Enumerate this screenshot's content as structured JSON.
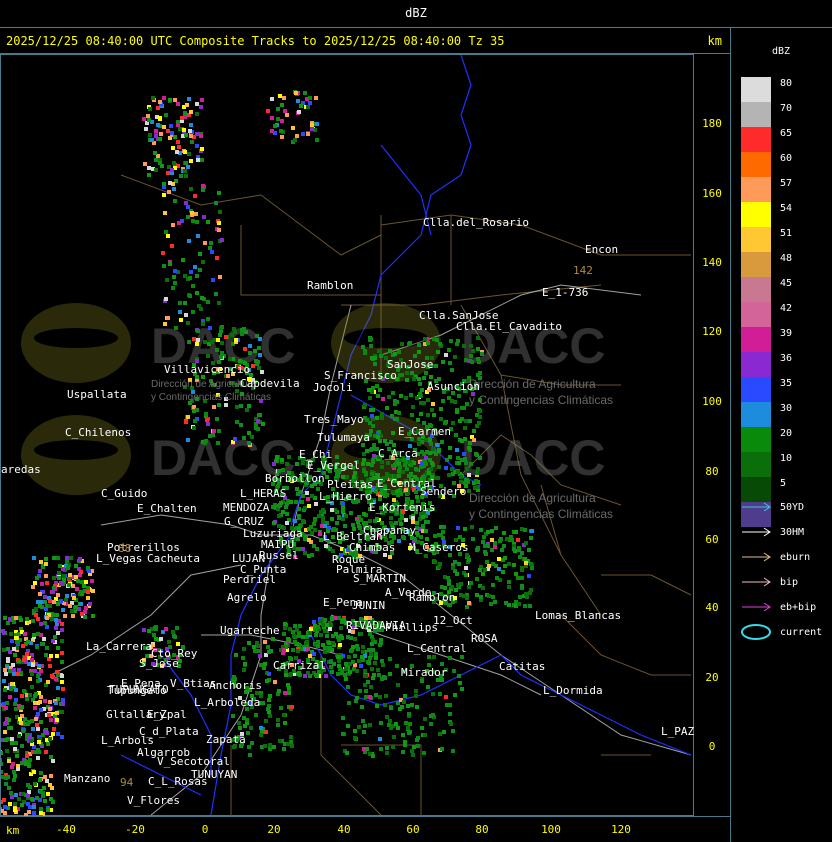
{
  "header": {
    "title": "dBZ"
  },
  "title_bar": {
    "text": "2025/12/25 08:40:00 UTC Composite Tracks to 2025/12/25 08:40:00 Tz 35",
    "unit_top": "km",
    "unit_bottom": "km"
  },
  "y_axis": {
    "ticks": [
      "180",
      "160",
      "140",
      "120",
      "100",
      "80",
      "60",
      "40",
      "20",
      "0"
    ]
  },
  "x_axis": {
    "ticks": [
      "-40",
      "-20",
      "0",
      "20",
      "40",
      "60",
      "80",
      "100",
      "120"
    ]
  },
  "legend": {
    "title": "dBZ",
    "scale": [
      {
        "label": "80",
        "color": "#dcdcdc"
      },
      {
        "label": "70",
        "color": "#b4b4b4"
      },
      {
        "label": "65",
        "color": "#ff2a2a"
      },
      {
        "label": "60",
        "color": "#ff6a00"
      },
      {
        "label": "57",
        "color": "#ff9a5a"
      },
      {
        "label": "54",
        "color": "#ffff00"
      },
      {
        "label": "51",
        "color": "#ffc832"
      },
      {
        "label": "48",
        "color": "#d89a3c"
      },
      {
        "label": "45",
        "color": "#c87890"
      },
      {
        "label": "42",
        "color": "#d2649a"
      },
      {
        "label": "39",
        "color": "#d21e96"
      },
      {
        "label": "36",
        "color": "#8a28d2"
      },
      {
        "label": "35",
        "color": "#2a4aff"
      },
      {
        "label": "30",
        "color": "#1e8cdc"
      },
      {
        "label": "20",
        "color": "#0a8a0a"
      },
      {
        "label": "10",
        "color": "#0a6e0a"
      },
      {
        "label": "5",
        "color": "#064a06"
      },
      {
        "label": "",
        "color": "#503c8c"
      }
    ],
    "tracks": [
      {
        "label": "50YD",
        "color": "#38c8d8"
      },
      {
        "label": "30HM",
        "color": "#ffffff"
      },
      {
        "label": "eburn",
        "color": "#e8c080"
      },
      {
        "label": "bip",
        "color": "#f0c0c0"
      },
      {
        "label": "eb+bip",
        "color": "#e040e0"
      },
      {
        "label": "current",
        "color": "#38d8e8"
      }
    ]
  },
  "watermark": {
    "brand": "DACC",
    "line1": "Dirección de Agricultura",
    "line2": "y Contingencias Climáticas"
  },
  "places": [
    {
      "name": "Clla.del_Rosario"
    },
    {
      "name": "Encon"
    },
    {
      "name": "E_1-736"
    },
    {
      "name": "142"
    },
    {
      "name": "Ramblon"
    },
    {
      "name": "Clla.SanJose"
    },
    {
      "name": "Clla.El_Cavadito"
    },
    {
      "name": "SanJose"
    },
    {
      "name": "Villavicencio"
    },
    {
      "name": "Capdevila"
    },
    {
      "name": "S_Francisco"
    },
    {
      "name": "Jocoli"
    },
    {
      "name": "Asuncion"
    },
    {
      "name": "Uspallata"
    },
    {
      "name": "Tres_Mayo"
    },
    {
      "name": "Tulumaya"
    },
    {
      "name": "E_Carmen"
    },
    {
      "name": "C_Chilenos"
    },
    {
      "name": "aredas"
    },
    {
      "name": "E_Chi"
    },
    {
      "name": "E_Vergel"
    },
    {
      "name": "C_Arca"
    },
    {
      "name": "Borbollon"
    },
    {
      "name": "Pleitas"
    },
    {
      "name": "E_Central"
    },
    {
      "name": "Sendero"
    },
    {
      "name": "C_Guido"
    },
    {
      "name": "L_HERAS"
    },
    {
      "name": "L_Hierro"
    },
    {
      "name": "E_Chalten"
    },
    {
      "name": "MENDOZA"
    },
    {
      "name": "E_Kortenis"
    },
    {
      "name": "G_CRUZ"
    },
    {
      "name": "Luzuriaga"
    },
    {
      "name": "Chapanay"
    },
    {
      "name": "Potrerillos"
    },
    {
      "name": "L_Beltran"
    },
    {
      "name": "MAIPU"
    },
    {
      "name": "Chimbas"
    },
    {
      "name": "M_Caseros"
    },
    {
      "name": "L_Vegas"
    },
    {
      "name": "Cacheuta"
    },
    {
      "name": "Russel"
    },
    {
      "name": "LUJAN"
    },
    {
      "name": "Roque"
    },
    {
      "name": "C_Punta"
    },
    {
      "name": "Palmira"
    },
    {
      "name": "Perdriel"
    },
    {
      "name": "S_MARTIN"
    },
    {
      "name": "A_Verde"
    },
    {
      "name": "Ramblon"
    },
    {
      "name": "Agrelo"
    },
    {
      "name": "E_Pena"
    },
    {
      "name": "JUNIN"
    },
    {
      "name": "Lomas_Blancas"
    },
    {
      "name": "RIVADAVIA"
    },
    {
      "name": "Phillips"
    },
    {
      "name": "12_Oct"
    },
    {
      "name": "Ugarteche"
    },
    {
      "name": "ROSA"
    },
    {
      "name": "La_Carrera"
    },
    {
      "name": "Cto_Rey"
    },
    {
      "name": "S_Jose"
    },
    {
      "name": "Carrizal"
    },
    {
      "name": "L_Central"
    },
    {
      "name": "Catitas"
    },
    {
      "name": "Tupungato"
    },
    {
      "name": "V_Btias"
    },
    {
      "name": "Anchoris"
    },
    {
      "name": "Mirador"
    },
    {
      "name": "E_Pena"
    },
    {
      "name": "TUPUNGATO"
    },
    {
      "name": "L_Dormida"
    },
    {
      "name": "L_Arboleda"
    },
    {
      "name": "Gltallary"
    },
    {
      "name": "E_Zpal"
    },
    {
      "name": "C_d_Plata"
    },
    {
      "name": "L_Arbols"
    },
    {
      "name": "Zapata"
    },
    {
      "name": "Algarrob"
    },
    {
      "name": "V_Secotoral"
    },
    {
      "name": "TUNUYAN"
    },
    {
      "name": "Manzano"
    },
    {
      "name": "C_L_Rosas"
    },
    {
      "name": "V_Flores"
    },
    {
      "name": "L_PAZ"
    },
    {
      "name": "88"
    },
    {
      "name": "94"
    }
  ]
}
